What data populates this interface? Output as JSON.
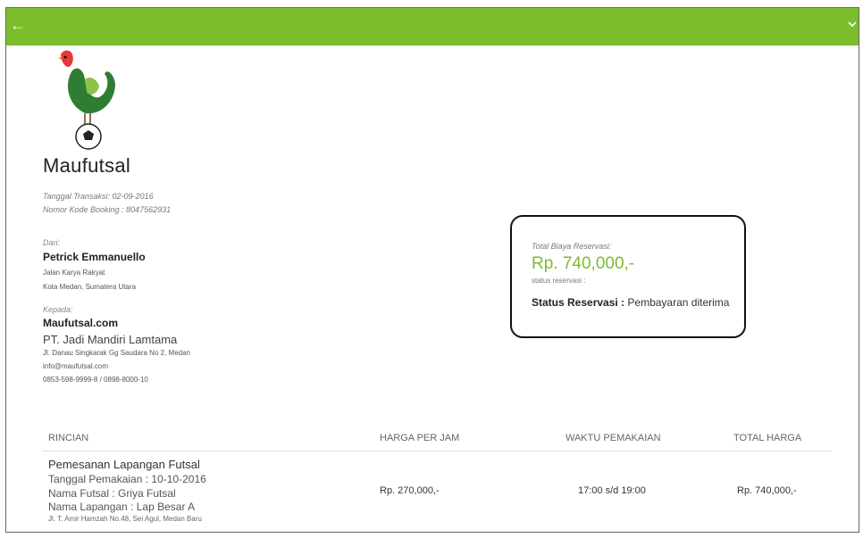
{
  "topbar": {
    "back_icon": "arrow-left-icon",
    "menu_icon": "chevron-down-icon",
    "color": "#7cbd2c"
  },
  "brand": {
    "name": "Maufutsal",
    "logo": "rooster-soccer-ball-logo"
  },
  "transaction": {
    "date": "Tanggal Transaksi: 02-09-2016",
    "booking_code": "Nomor Kode Booking : 8047562931"
  },
  "from": {
    "label": "Dari:",
    "name": "Petrick Emmanuello",
    "address1": "Jalan Karya Rakyat",
    "address2": "Kota Medan, Sumatera Utara"
  },
  "to": {
    "label": "Kepada:",
    "name": "Maufutsal.com",
    "company": "PT. Jadi Mandiri Lamtama",
    "address": "Jl. Danau Singkarak Gg Saudara No 2, Medan",
    "email": "info@maufutsal.com",
    "phone": "0853-598-9999-8 / 0898-8000-10"
  },
  "summary": {
    "total_label": "Total Biaya Reservasi:",
    "total_amount": "Rp. 740,000,-",
    "status_small": "status reservasi :",
    "status_label": "Status Reservasi :",
    "status_value": "Pembayaran diterima",
    "amount_color": "#7cbd2c"
  },
  "table": {
    "headers": [
      "RINCIAN",
      "HARGA PER JAM",
      "WAKTU PEMAKAIAN",
      "TOTAL HARGA"
    ],
    "row": {
      "title": "Pemesanan Lapangan Futsal",
      "date": "Tanggal Pemakaian : 10-10-2016",
      "venue": "Nama Futsal : Griya Futsal",
      "field": "Nama Lapangan : Lap Besar A",
      "address": "Jl. T. Amir Hamzah No.48, Sei Agul, Medan Baru",
      "price_per_hour": "Rp. 270,000,-",
      "time": "17:00 s/d 19:00",
      "total": "Rp. 740,000,-"
    }
  }
}
